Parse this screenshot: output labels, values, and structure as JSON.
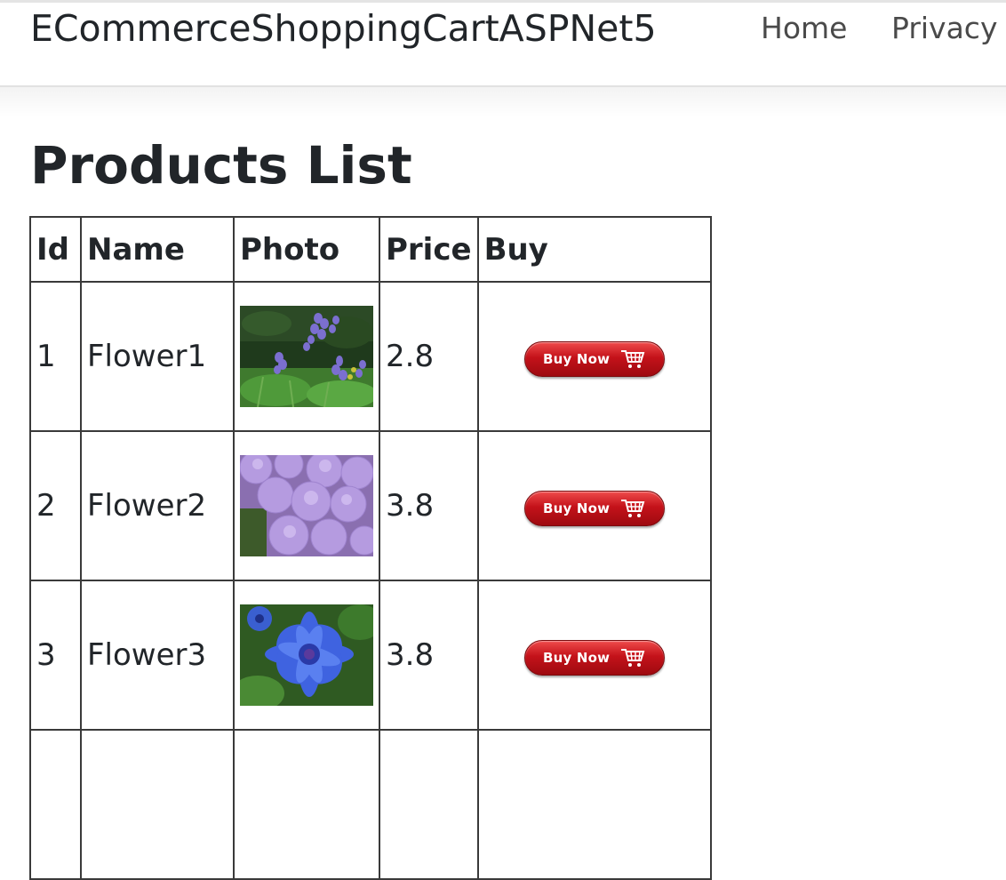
{
  "navbar": {
    "brand": "ECommerceShoppingCartASPNet5",
    "links": [
      "Home",
      "Privacy"
    ]
  },
  "page": {
    "title": "Products List"
  },
  "table": {
    "headers": [
      "Id",
      "Name",
      "Photo",
      "Price",
      "Buy"
    ],
    "rows": [
      {
        "id": "1",
        "name": "Flower1",
        "price": "2.8",
        "buy_label": "Buy Now",
        "photo_icon": "flower-purple-spikes-photo"
      },
      {
        "id": "2",
        "name": "Flower2",
        "price": "3.8",
        "buy_label": "Buy Now",
        "photo_icon": "flower-lilac-pom-photo"
      },
      {
        "id": "3",
        "name": "Flower3",
        "price": "3.8",
        "buy_label": "Buy Now",
        "photo_icon": "flower-blue-cornflower-photo"
      }
    ]
  },
  "colors": {
    "text": "#212529",
    "buy_button": "#c4121a",
    "border": "#3a3a3a"
  }
}
